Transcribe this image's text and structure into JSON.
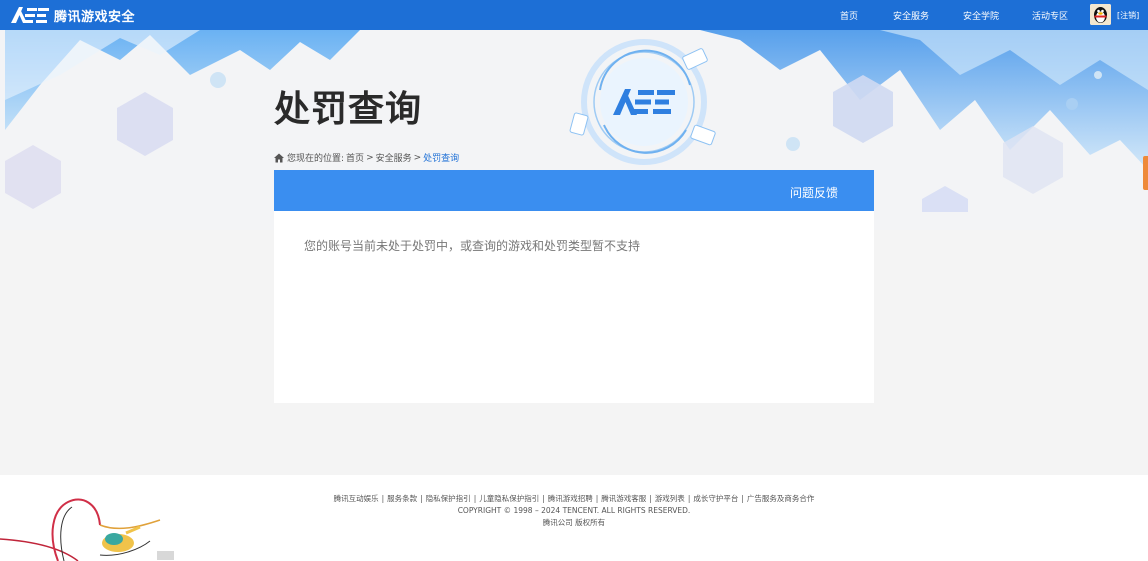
{
  "header": {
    "logo_text": "腾讯游戏安全",
    "logo_mark": "ACE",
    "nav": [
      {
        "label": "首页"
      },
      {
        "label": "安全服务"
      },
      {
        "label": "安全学院"
      },
      {
        "label": "活动专区"
      }
    ],
    "logout_label": "[注销]"
  },
  "hero": {
    "title": "处罚查询",
    "emblem_text": "ACE"
  },
  "breadcrumb": {
    "prefix": "您现在的位置:",
    "items": [
      "首页",
      "安全服务",
      "处罚查询"
    ],
    "separator": ">"
  },
  "panel": {
    "feedback_label": "问题反馈",
    "message": "您的账号当前未处于处罚中，或查询的游戏和处罚类型暂不支持"
  },
  "footer": {
    "links": [
      "腾讯互动娱乐",
      "服务条款",
      "隐私保护指引",
      "儿童隐私保护指引",
      "腾讯游戏招聘",
      "腾讯游戏客服",
      "游戏列表",
      "成长守护平台",
      "广告服务及商务合作"
    ],
    "link_separator": "|",
    "copyright": "COPYRIGHT © 1998 – 2024 TENCENT. ALL RIGHTS RESERVED.",
    "company": "腾讯公司 版权所有"
  },
  "colors": {
    "topbar": "#1d6fd6",
    "panel_header": "#3a8ef0",
    "breadcrumb_current": "#1d6fd6"
  }
}
